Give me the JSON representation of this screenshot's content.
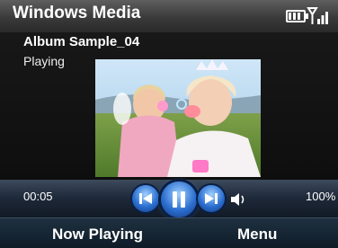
{
  "titlebar": {
    "title": "Windows Media"
  },
  "status_icons": {
    "battery": "battery-icon",
    "signal": "signal-icon"
  },
  "track": {
    "album_title": "Album Sample_04",
    "status": "Playing"
  },
  "playback": {
    "elapsed": "00:05",
    "volume": "100%"
  },
  "controls": {
    "previous": "previous-icon",
    "play_pause": "pause-icon",
    "next": "next-icon",
    "speaker": "speaker-icon"
  },
  "softkeys": {
    "left": "Now Playing",
    "right": "Menu"
  },
  "colors": {
    "accent": "#2c6fd0",
    "softkey_bg": "#14222f"
  }
}
